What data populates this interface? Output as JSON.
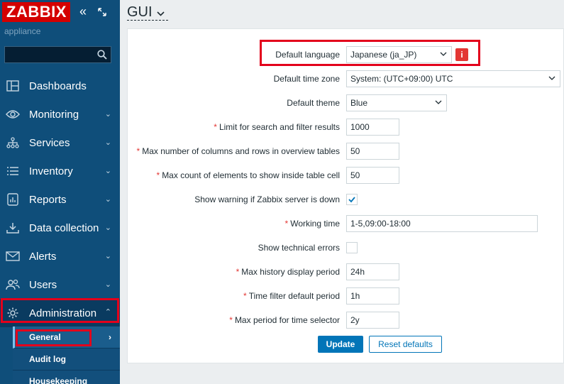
{
  "sidebar": {
    "logo": "ZABBIX",
    "subtitle": "appliance",
    "search": {
      "value": "",
      "placeholder": ""
    },
    "items": [
      {
        "label": "Dashboards",
        "icon": "dashboards-icon"
      },
      {
        "label": "Monitoring",
        "icon": "eye-icon"
      },
      {
        "label": "Services",
        "icon": "services-icon"
      },
      {
        "label": "Inventory",
        "icon": "list-icon"
      },
      {
        "label": "Reports",
        "icon": "reports-icon"
      },
      {
        "label": "Data collection",
        "icon": "download-icon"
      },
      {
        "label": "Alerts",
        "icon": "envelope-icon"
      },
      {
        "label": "Users",
        "icon": "users-icon"
      },
      {
        "label": "Administration",
        "icon": "gear-icon"
      }
    ],
    "submenu": [
      {
        "label": "General"
      },
      {
        "label": "Audit log"
      },
      {
        "label": "Housekeeping"
      }
    ]
  },
  "header": {
    "title": "GUI"
  },
  "form": {
    "default_language": {
      "label": "Default language",
      "value": "Japanese (ja_JP)"
    },
    "default_time_zone": {
      "label": "Default time zone",
      "value": "System: (UTC+09:00) UTC"
    },
    "default_theme": {
      "label": "Default theme",
      "value": "Blue"
    },
    "search_limit": {
      "label": "Limit for search and filter results",
      "value": "1000"
    },
    "max_overview": {
      "label": "Max number of columns and rows in overview tables",
      "value": "50"
    },
    "max_table_cell": {
      "label": "Max count of elements to show inside table cell",
      "value": "50"
    },
    "server_warning": {
      "label": "Show warning if Zabbix server is down",
      "checked": true
    },
    "working_time": {
      "label": "Working time",
      "value": "1-5,09:00-18:00"
    },
    "technical_errors": {
      "label": "Show technical errors",
      "checked": false
    },
    "history_period": {
      "label": "Max history display period",
      "value": "24h"
    },
    "time_filter_period": {
      "label": "Time filter default period",
      "value": "1h"
    },
    "max_period": {
      "label": "Max period for time selector",
      "value": "2y"
    },
    "update_label": "Update",
    "reset_label": "Reset defaults"
  },
  "colors": {
    "sidebar": "#0f4e7a",
    "accent": "#0275b8",
    "highlight": "#e3001b"
  }
}
